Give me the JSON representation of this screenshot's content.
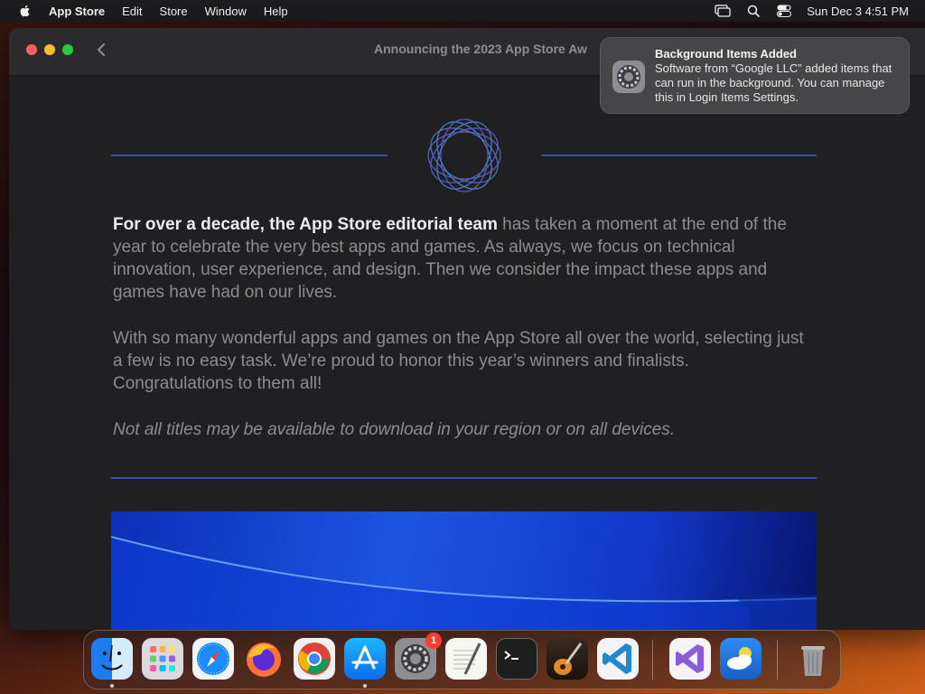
{
  "menubar": {
    "app_name": "App Store",
    "items": [
      "Edit",
      "Store",
      "Window",
      "Help"
    ],
    "clock": "Sun Dec 3  4:51 PM"
  },
  "window": {
    "title": "Announcing the 2023 App Store Aw"
  },
  "article": {
    "intro_bold": "For over a decade, the App Store editorial team",
    "intro_rest": " has taken a moment at the end of the year to celebrate the very best apps and games. As always, we focus on technical innovation, user experience, and design. Then we consider the impact these apps and games have had on our lives.",
    "paragraph2": "With so many wonderful apps and games on the App Store all over the world, selecting just a few is no easy task. We’re proud to honor this year’s winners and finalists. Congratulations to them all!",
    "note": "Not all titles may be available to download in your region or on all devices."
  },
  "notification": {
    "title": "Background Items Added",
    "body": "Software from “Google LLC” added items that can run in the background. You can manage this in Login Items Settings."
  },
  "dock": {
    "settings_badge": "1",
    "items": [
      "finder",
      "launchpad",
      "safari",
      "firefox",
      "chrome",
      "app-store",
      "system-settings",
      "textedit",
      "terminal",
      "garageband",
      "vscode",
      "visual-studio",
      "weather",
      "trash"
    ]
  },
  "colors": {
    "accent_line": "#3a4fb0",
    "window_bg": "#202022",
    "badge": "#ff3b30"
  }
}
